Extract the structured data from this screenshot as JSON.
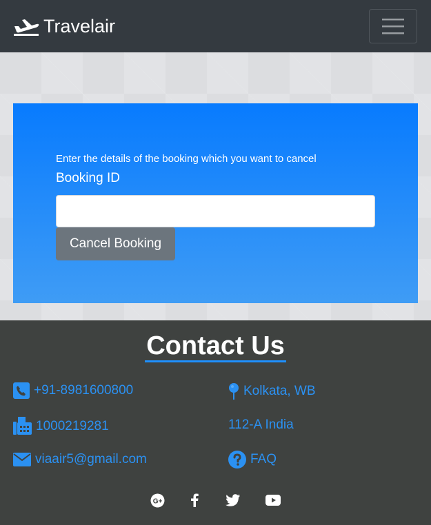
{
  "navbar": {
    "brand": "Travelair",
    "icons": {
      "brand": "plane-icon",
      "toggler": "hamburger-menu-icon"
    }
  },
  "cancel_form": {
    "instruction": "Enter the details of the booking which you want to cancel",
    "field_label": "Booking ID",
    "booking_id_value": "",
    "button_label": "Cancel Booking"
  },
  "footer": {
    "title": "Contact Us",
    "contacts": {
      "phone": "+91-8981600800",
      "fax": "1000219281",
      "email": "viaair5@gmail.com",
      "location": "Kolkata, WB",
      "address": "112-A India",
      "faq": "FAQ"
    },
    "social": [
      "google-plus-icon",
      "facebook-icon",
      "twitter-icon",
      "youtube-icon"
    ]
  },
  "colors": {
    "navbar": "#343a40",
    "card_top": "#087bfe",
    "card_bottom": "#3f9cf5",
    "button": "#6c757d",
    "footer": "#3f4240",
    "link": "#2b91f2"
  }
}
